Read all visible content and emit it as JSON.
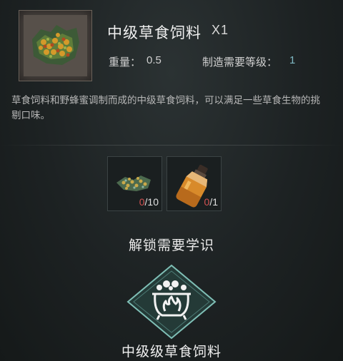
{
  "item": {
    "name": "中级草食饲料",
    "quantity": "X1",
    "icon": "herbivore-feed-icon",
    "weight_label": "重量：",
    "weight_value": "0.5",
    "level_label": "制造需要等级：",
    "level_value": "1",
    "description": "草食饲料和野蜂蜜调制而成的中级草食饲料，可以满足一些草食生物的挑剔口味。"
  },
  "ingredients": [
    {
      "icon": "herbivore-feed-ingredient-icon",
      "have": "0",
      "need": "/10"
    },
    {
      "icon": "honey-jar-icon",
      "have": "0",
      "need": "/1"
    }
  ],
  "unlock": {
    "heading": "解锁需要学识",
    "knowledge_icon": "cauldron-icon",
    "knowledge_name": "中级级草食饲料"
  },
  "colors": {
    "background": "#1d2223",
    "level_value": "#7fb8c3",
    "count_missing": "#d35252",
    "badge_border": "#7fbfb6"
  }
}
